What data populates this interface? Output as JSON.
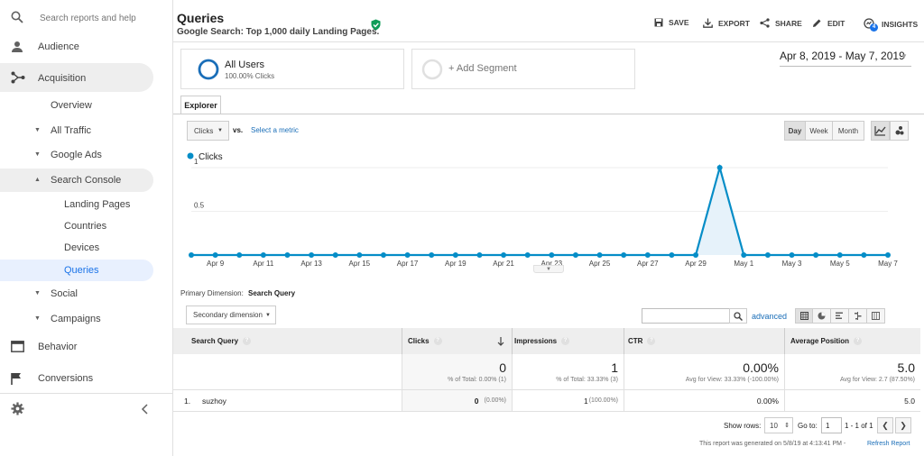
{
  "sidebar": {
    "search_placeholder": "Search reports and help",
    "audience": "Audience",
    "acquisition": "Acquisition",
    "overview": "Overview",
    "all_traffic": "All Traffic",
    "google_ads": "Google Ads",
    "search_console": "Search Console",
    "landing_pages": "Landing Pages",
    "countries": "Countries",
    "devices": "Devices",
    "queries": "Queries",
    "social": "Social",
    "campaigns": "Campaigns",
    "behavior": "Behavior",
    "conversions": "Conversions"
  },
  "header": {
    "title": "Queries",
    "subtitle": "Google Search: Top 1,000 daily Landing Pages.",
    "save": "SAVE",
    "export": "EXPORT",
    "share": "SHARE",
    "edit": "EDIT",
    "insights": "INSIGHTS",
    "insights_badge": "4"
  },
  "segments": {
    "all_users": "All Users",
    "all_users_sub": "100.00% Clicks",
    "add_segment": "+ Add Segment"
  },
  "date_range": "Apr 8, 2019 - May 7, 2019",
  "explorer": {
    "tab": "Explorer",
    "metric": "Clicks",
    "vs": "vs.",
    "select_metric": "Select a metric",
    "day": "Day",
    "week": "Week",
    "month": "Month"
  },
  "chart_data": {
    "type": "line",
    "series": [
      {
        "name": "Clicks",
        "values": [
          0,
          0,
          0,
          0,
          0,
          0,
          0,
          0,
          0,
          0,
          0,
          0,
          0,
          0,
          0,
          0,
          0,
          0,
          0,
          0,
          0,
          0,
          1,
          0,
          0,
          0,
          0,
          0,
          0,
          0
        ]
      }
    ],
    "x": [
      "Apr 8",
      "Apr 9",
      "Apr 10",
      "Apr 11",
      "Apr 12",
      "Apr 13",
      "Apr 14",
      "Apr 15",
      "Apr 16",
      "Apr 17",
      "Apr 18",
      "Apr 19",
      "Apr 20",
      "Apr 21",
      "Apr 22",
      "Apr 23",
      "Apr 24",
      "Apr 25",
      "Apr 26",
      "Apr 27",
      "Apr 28",
      "Apr 29",
      "Apr 30",
      "May 1",
      "May 2",
      "May 3",
      "May 4",
      "May 5",
      "May 6",
      "May 7"
    ],
    "x_tick_labels": [
      "Apr 9",
      "Apr 11",
      "Apr 13",
      "Apr 15",
      "Apr 17",
      "Apr 19",
      "Apr 21",
      "Apr 23",
      "Apr 25",
      "Apr 27",
      "Apr 29",
      "May 1",
      "May 3",
      "May 5",
      "May 7"
    ],
    "y_tick_labels": [
      "1",
      "0.5"
    ],
    "ylim": [
      0,
      1
    ],
    "color": "#058dc7"
  },
  "table": {
    "primary_dimension_label": "Primary Dimension:",
    "primary_dimension_value": "Search Query",
    "secondary_dimension": "Secondary dimension",
    "advanced": "advanced",
    "columns": [
      "Search Query",
      "Clicks",
      "Impressions",
      "CTR",
      "Average Position"
    ],
    "totals": {
      "clicks": "0",
      "clicks_sub": "% of Total: 0.00% (1)",
      "impressions": "1",
      "impressions_sub": "% of Total: 33.33% (3)",
      "ctr": "0.00%",
      "ctr_sub": "Avg for View: 33.33% (-100.00%)",
      "avg_position": "5.0",
      "avg_position_sub": "Avg for View: 2.7 (87.50%)"
    },
    "rows": [
      {
        "index": "1.",
        "query": "suzhoy",
        "clicks": "0",
        "clicks_pct": "(0.00%)",
        "impressions": "1",
        "impressions_pct": "(100.00%)",
        "ctr": "0.00%",
        "avg_position": "5.0"
      }
    ],
    "show_rows_label": "Show rows:",
    "show_rows_value": "10",
    "goto_label": "Go to:",
    "goto_value": "1",
    "range": "1 - 1 of 1",
    "generated": "This report was generated on 5/8/19 at 4:13:41 PM -",
    "refresh": "Refresh Report"
  }
}
